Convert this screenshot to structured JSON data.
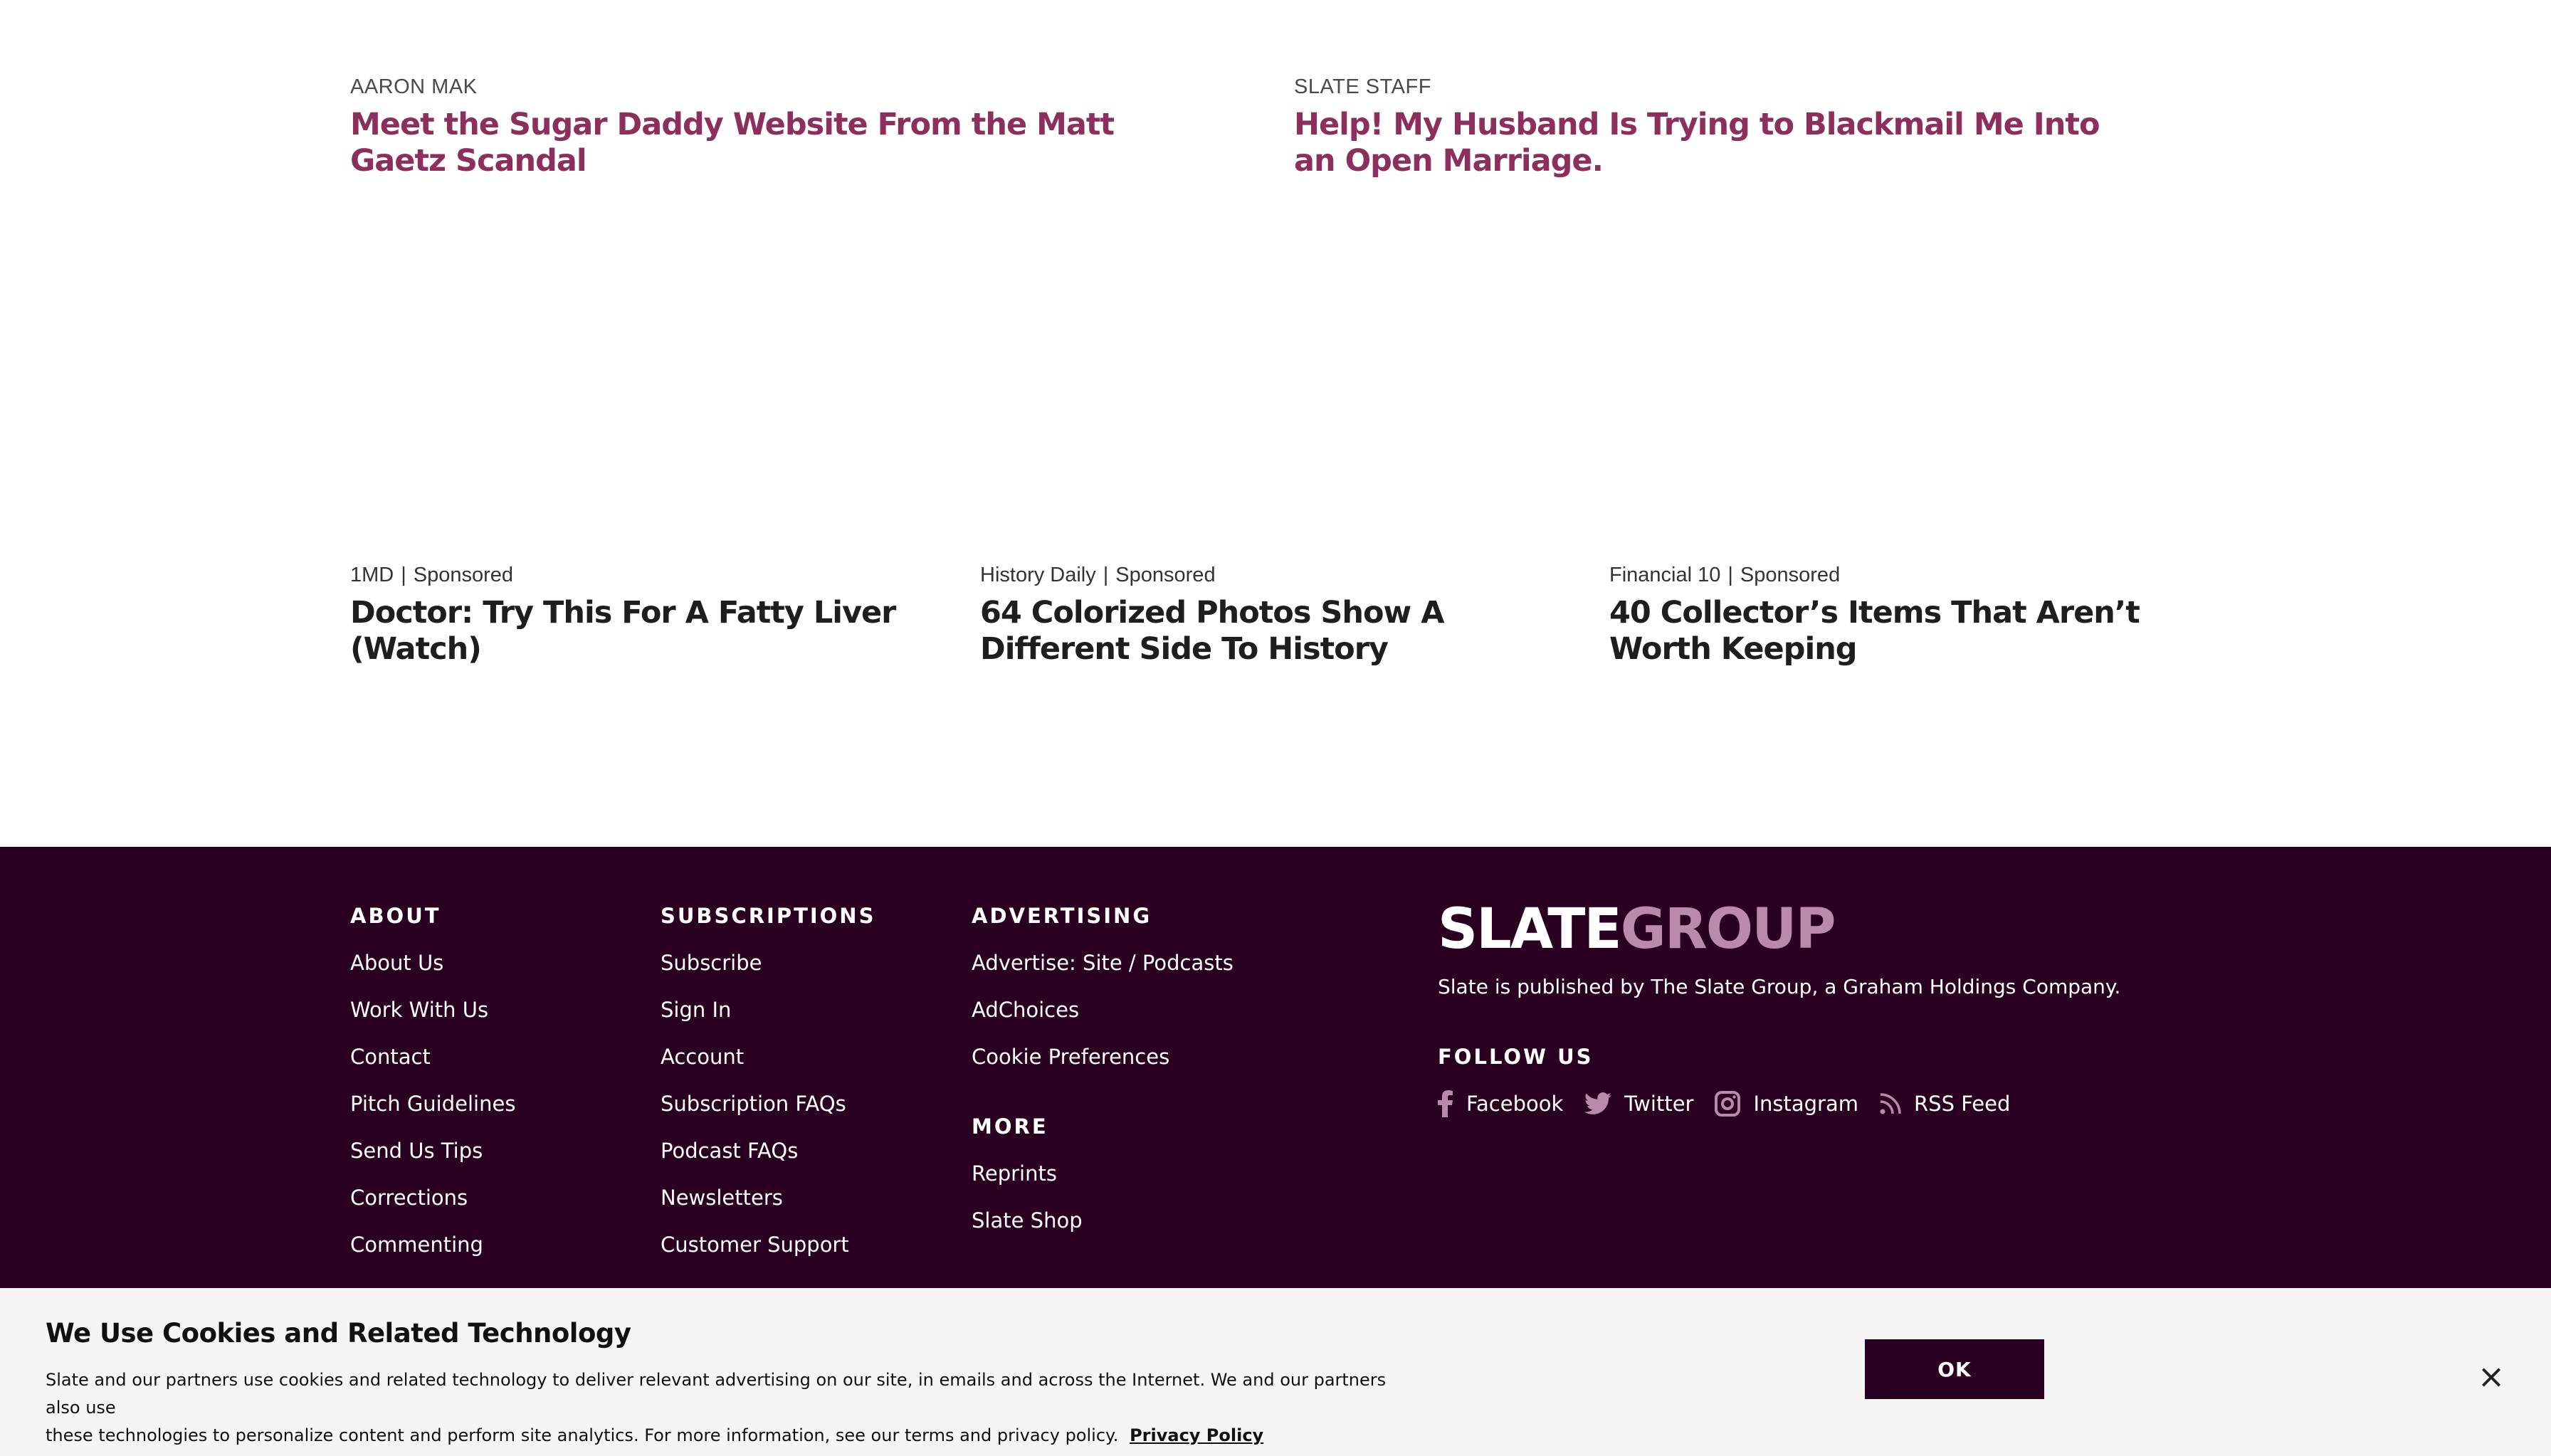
{
  "related": [
    {
      "author": "AARON MAK",
      "title": "Meet the Sugar Daddy Website From the Matt Gaetz Scandal"
    },
    {
      "author": "SLATE STAFF",
      "title": "Help! My Husband Is Trying to Blackmail Me Into an Open Marriage."
    }
  ],
  "sponsored": [
    {
      "source": "1MD",
      "label": "Sponsored",
      "title": "Doctor: Try This For A Fatty Liver (Watch)"
    },
    {
      "source": "History Daily",
      "label": "Sponsored",
      "title": "64 Colorized Photos Show A Different Side To History"
    },
    {
      "source": "Financial 10",
      "label": "Sponsored",
      "title": "40 Collector’s Items That Aren’t Worth Keeping"
    }
  ],
  "footer": {
    "about": {
      "heading": "ABOUT",
      "links": [
        "About Us",
        "Work With Us",
        "Contact",
        "Pitch Guidelines",
        "Send Us Tips",
        "Corrections",
        "Commenting"
      ]
    },
    "subscriptions": {
      "heading": "SUBSCRIPTIONS",
      "links": [
        "Subscribe",
        "Sign In",
        "Account",
        "Subscription FAQs",
        "Podcast FAQs",
        "Newsletters",
        "Customer Support"
      ]
    },
    "advertising": {
      "heading": "ADVERTISING",
      "links": [
        "Advertise: Site / Podcasts",
        "AdChoices",
        "Cookie Preferences"
      ]
    },
    "more": {
      "heading": "MORE",
      "links": [
        "Reprints",
        "Slate Shop"
      ]
    },
    "brand": {
      "logo_slate": "SLATE",
      "logo_group": "GROUP",
      "published": "Slate is published by The Slate Group, a Graham Holdings Company."
    },
    "follow": {
      "heading": "FOLLOW US",
      "facebook": "Facebook",
      "twitter": "Twitter",
      "instagram": "Instagram",
      "rss": "RSS Feed"
    }
  },
  "cookie": {
    "title": "We Use Cookies and Related Technology",
    "text_line1": "Slate and our partners use cookies and related technology to deliver relevant advertising on our site, in emails and across the Internet. We and our partners also use",
    "text_line2": "these technologies to personalize content and perform site analytics. For more information, see our terms and privacy policy.",
    "policy_link": "Privacy Policy",
    "ok_label": "OK",
    "close_symbol": "×"
  },
  "colors": {
    "accent": "#8d2f5d",
    "footer_bg": "#2a0020",
    "logo_group": "#b98aa9",
    "banner_bg": "#f5f5f5"
  }
}
